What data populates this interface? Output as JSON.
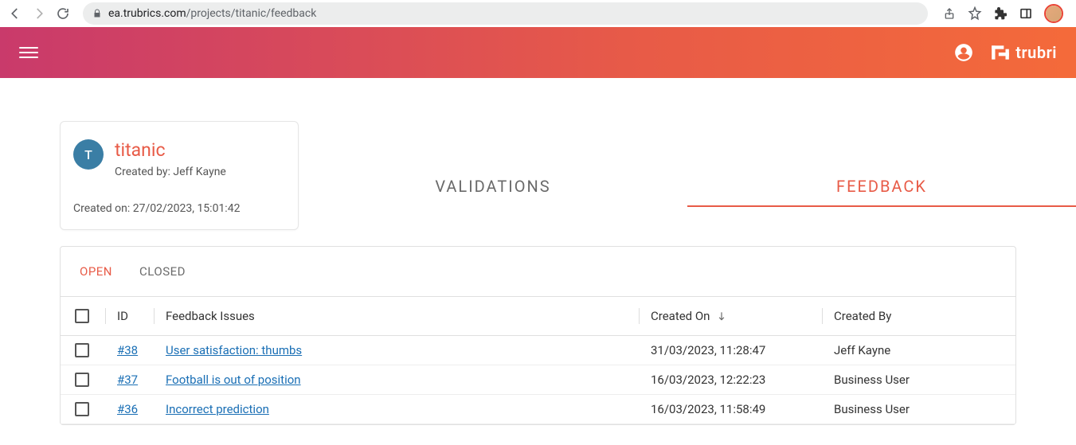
{
  "browser": {
    "url_host": "ea.trubrics.com",
    "url_path": "/projects/titanic/feedback"
  },
  "brand": {
    "name": "trubri"
  },
  "project": {
    "avatar_letter": "T",
    "title": "titanic",
    "created_by_label": "Created by: Jeff Kayne",
    "created_on_label": "Created on: 27/02/2023, 15:01:42"
  },
  "main_tabs": {
    "validations": "VALIDATIONS",
    "feedback": "FEEDBACK"
  },
  "sub_tabs": {
    "open": "OPEN",
    "closed": "CLOSED"
  },
  "table": {
    "headers": {
      "id": "ID",
      "title": "Feedback Issues",
      "created_on": "Created On",
      "created_by": "Created By"
    },
    "rows": [
      {
        "id": "#38",
        "title": "User satisfaction: thumbs",
        "created_on": "31/03/2023, 11:28:47",
        "created_by": "Jeff Kayne"
      },
      {
        "id": "#37",
        "title": "Football is out of position",
        "created_on": "16/03/2023, 12:22:23",
        "created_by": "Business User"
      },
      {
        "id": "#36",
        "title": "Incorrect prediction",
        "created_on": "16/03/2023, 11:58:49",
        "created_by": "Business User"
      }
    ]
  }
}
